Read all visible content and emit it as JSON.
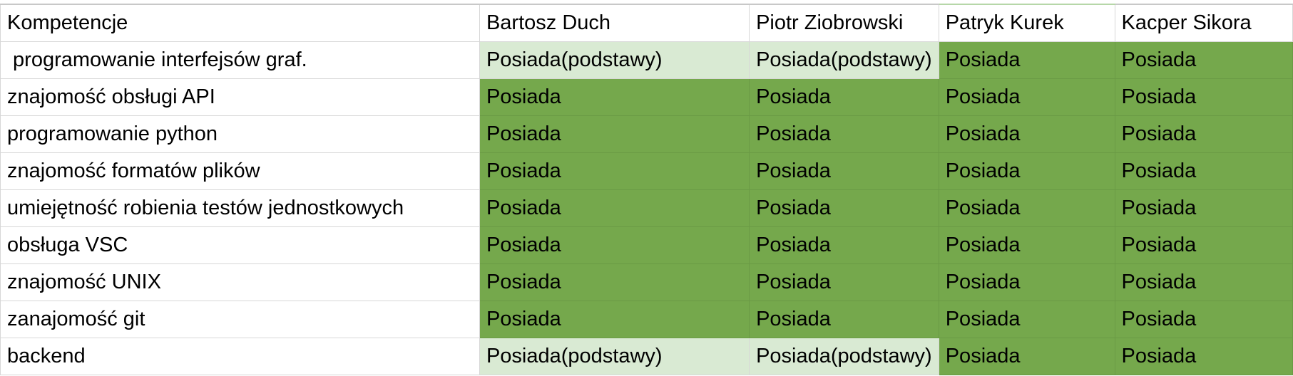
{
  "colors": {
    "full": "#75a84c",
    "basic": "#d9ead3",
    "grid": "#d7d7d7"
  },
  "header": [
    "Kompetencje",
    "Bartosz Duch",
    "Piotr Ziobrowski",
    "Patryk Kurek",
    "Kacper Sikora"
  ],
  "rows": [
    {
      "skill": " programowanie interfejsów graf.",
      "values": [
        "Posiada(podstawy)",
        "Posiada(podstawy)",
        "Posiada",
        "Posiada"
      ],
      "levels": [
        "basic",
        "basic",
        "full",
        "full"
      ]
    },
    {
      "skill": "znajomość obsługi API",
      "values": [
        "Posiada",
        "Posiada",
        "Posiada",
        "Posiada"
      ],
      "levels": [
        "full",
        "full",
        "full",
        "full"
      ]
    },
    {
      "skill": "programowanie python",
      "values": [
        "Posiada",
        "Posiada",
        "Posiada",
        "Posiada"
      ],
      "levels": [
        "full",
        "full",
        "full",
        "full"
      ]
    },
    {
      "skill": "znajomość formatów plików",
      "values": [
        "Posiada",
        "Posiada",
        "Posiada",
        "Posiada"
      ],
      "levels": [
        "full",
        "full",
        "full",
        "full"
      ]
    },
    {
      "skill": "umiejętność robienia testów jednostkowych",
      "values": [
        "Posiada",
        "Posiada",
        "Posiada",
        "Posiada"
      ],
      "levels": [
        "full",
        "full",
        "full",
        "full"
      ]
    },
    {
      "skill": "obsługa VSC",
      "values": [
        "Posiada",
        "Posiada",
        "Posiada",
        "Posiada"
      ],
      "levels": [
        "full",
        "full",
        "full",
        "full"
      ]
    },
    {
      "skill": "znajomość UNIX",
      "values": [
        "Posiada",
        "Posiada",
        "Posiada",
        "Posiada"
      ],
      "levels": [
        "full",
        "full",
        "full",
        "full"
      ]
    },
    {
      "skill": "zanajomość git",
      "values": [
        "Posiada",
        "Posiada",
        "Posiada",
        "Posiada"
      ],
      "levels": [
        "full",
        "full",
        "full",
        "full"
      ]
    },
    {
      "skill": "backend",
      "values": [
        "Posiada(podstawy)",
        "Posiada(podstawy)",
        "Posiada",
        "Posiada"
      ],
      "levels": [
        "basic",
        "basic",
        "full",
        "full"
      ]
    }
  ]
}
